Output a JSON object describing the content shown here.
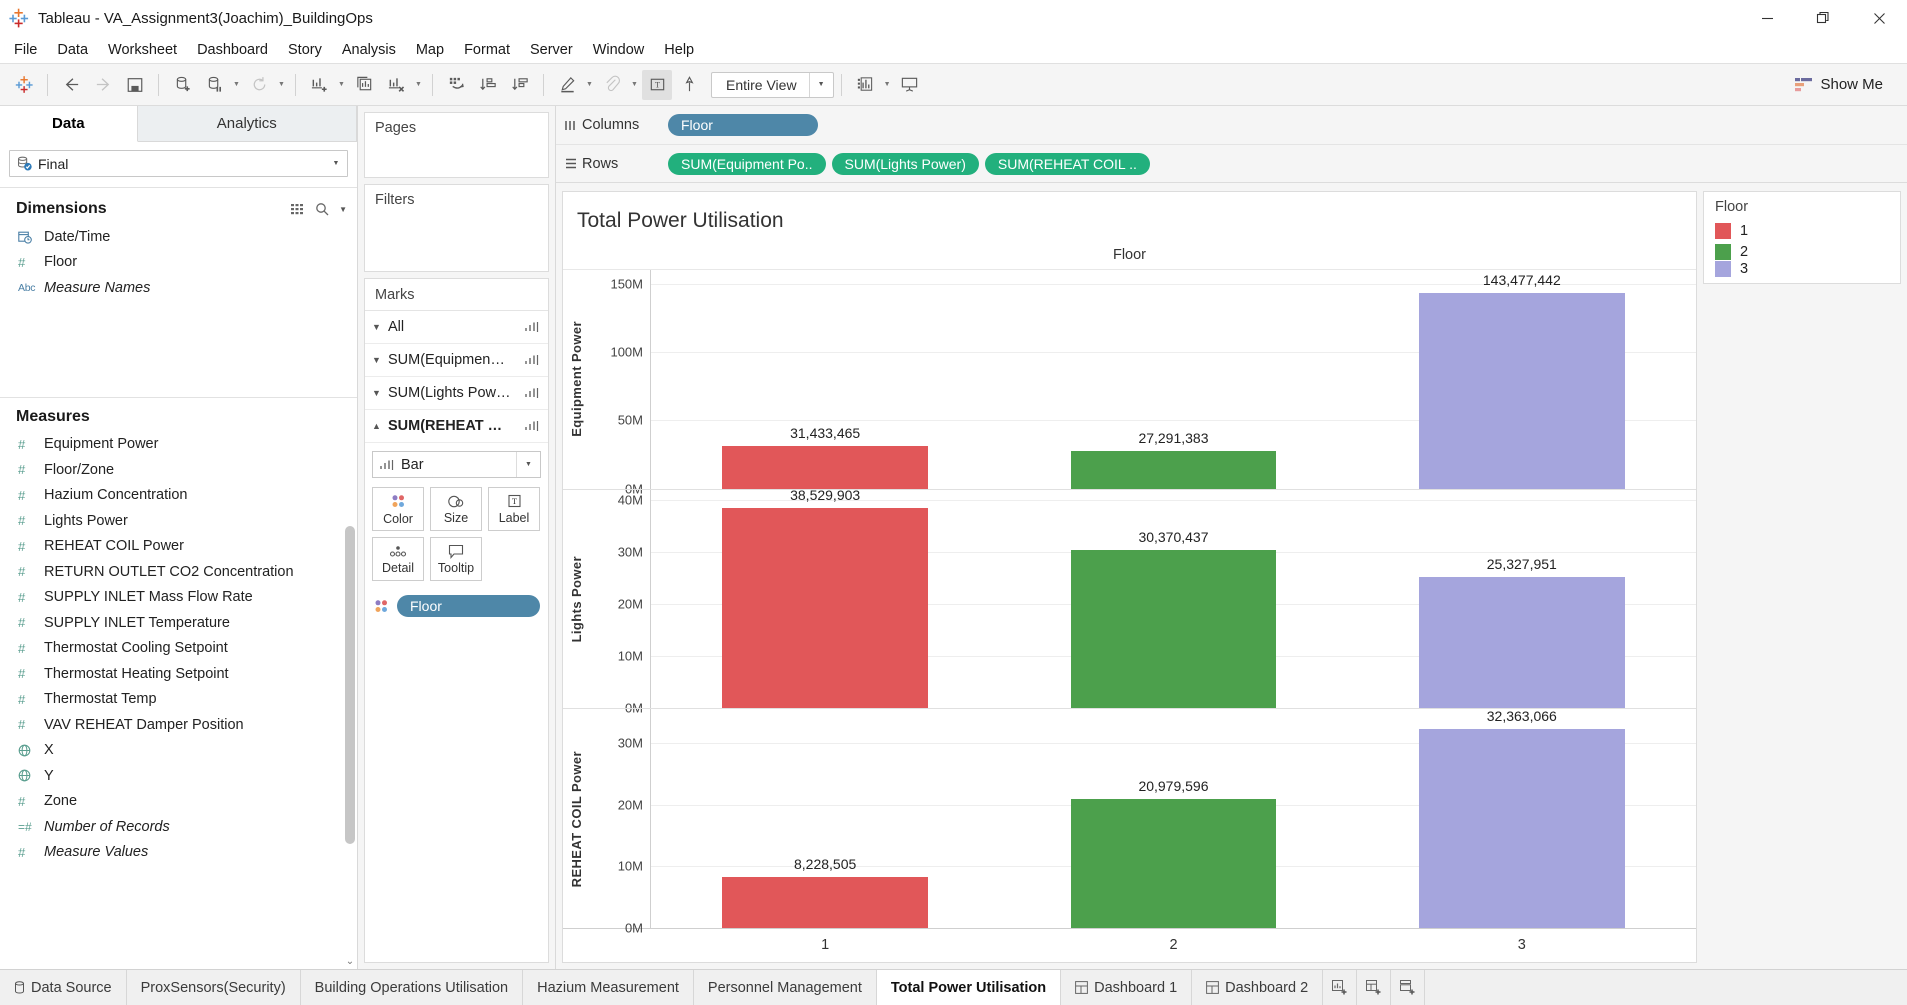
{
  "window": {
    "title": "Tableau - VA_Assignment3(Joachim)_BuildingOps",
    "app_icon": "tableau-logo-icon",
    "minimize": "–",
    "maximize": "❐",
    "close": "✕"
  },
  "menubar": {
    "items": [
      "File",
      "Data",
      "Worksheet",
      "Dashboard",
      "Story",
      "Analysis",
      "Map",
      "Format",
      "Server",
      "Window",
      "Help"
    ]
  },
  "toolbar": {
    "fit_value": "Entire View",
    "show_me_label": "Show Me",
    "icons": [
      "tableau-home-icon",
      "back-arrow-icon",
      "forward-arrow-icon",
      "save-icon",
      "new-data-source-icon",
      "pause-data-updates-icon",
      "refresh-data-source-icon",
      "new-worksheet-icon",
      "duplicate-sheet-icon",
      "clear-sheet-icon",
      "swap-rows-columns-icon",
      "sort-ascending-icon",
      "sort-descending-icon",
      "highlight-icon",
      "group-members-icon",
      "show-mark-labels-icon",
      "fix-axes-icon",
      "presentation-mode-icon",
      "show-me-icon"
    ]
  },
  "data_pane": {
    "tabs": [
      {
        "label": "Data",
        "active": true
      },
      {
        "label": "Analytics",
        "active": false
      }
    ],
    "datasource": {
      "name": "Final",
      "icon": "database-connected-icon"
    },
    "dimensions": {
      "header": "Dimensions",
      "tool_icons": [
        "grid-view-icon",
        "search-icon",
        "chevron-down-icon"
      ],
      "fields": [
        {
          "label": "Date/Time",
          "icon": "calendar-clock-icon",
          "italic": false
        },
        {
          "label": "Floor",
          "icon": "hash-icon",
          "italic": false
        },
        {
          "label": "Measure Names",
          "icon": "abc-icon",
          "italic": true
        }
      ]
    },
    "measures": {
      "header": "Measures",
      "fields": [
        {
          "label": "Equipment Power",
          "icon": "hash-icon",
          "italic": false
        },
        {
          "label": "Floor/Zone",
          "icon": "hash-icon",
          "italic": false
        },
        {
          "label": "Hazium Concentration",
          "icon": "hash-icon",
          "italic": false
        },
        {
          "label": "Lights Power",
          "icon": "hash-icon",
          "italic": false
        },
        {
          "label": "REHEAT COIL Power",
          "icon": "hash-icon",
          "italic": false
        },
        {
          "label": "RETURN OUTLET CO2 Concentration",
          "icon": "hash-icon",
          "italic": false
        },
        {
          "label": "SUPPLY INLET Mass Flow Rate",
          "icon": "hash-icon",
          "italic": false
        },
        {
          "label": "SUPPLY INLET Temperature",
          "icon": "hash-icon",
          "italic": false
        },
        {
          "label": "Thermostat Cooling Setpoint",
          "icon": "hash-icon",
          "italic": false
        },
        {
          "label": "Thermostat Heating Setpoint",
          "icon": "hash-icon",
          "italic": false
        },
        {
          "label": "Thermostat Temp",
          "icon": "hash-icon",
          "italic": false
        },
        {
          "label": "VAV REHEAT Damper Position",
          "icon": "hash-icon",
          "italic": false
        },
        {
          "label": "X",
          "icon": "geo-globe-icon",
          "italic": false
        },
        {
          "label": "Y",
          "icon": "geo-globe-icon",
          "italic": false
        },
        {
          "label": "Zone",
          "icon": "hash-icon",
          "italic": false
        },
        {
          "label": "Number of Records",
          "icon": "calculated-hash-icon",
          "italic": true
        },
        {
          "label": "Measure Values",
          "icon": "hash-icon",
          "italic": true
        }
      ]
    }
  },
  "cards": {
    "pages_header": "Pages",
    "filters_header": "Filters",
    "marks_header": "Marks",
    "mark_rows": [
      {
        "label": "All",
        "expanded": false,
        "active": false
      },
      {
        "label": "SUM(Equipmen…",
        "expanded": false,
        "active": false
      },
      {
        "label": "SUM(Lights Pow…",
        "expanded": false,
        "active": false
      },
      {
        "label": "SUM(REHEAT …",
        "expanded": true,
        "active": true
      }
    ],
    "mark_type": "Bar",
    "buttons": [
      {
        "label": "Color",
        "icon": "color-palette-icon"
      },
      {
        "label": "Size",
        "icon": "size-icon"
      },
      {
        "label": "Label",
        "icon": "label-text-icon"
      },
      {
        "label": "Detail",
        "icon": "detail-dots-icon"
      },
      {
        "label": "Tooltip",
        "icon": "tooltip-bubble-icon"
      }
    ],
    "color_pill": "Floor"
  },
  "shelves": {
    "columns_label": "Columns",
    "columns_icon": "columns-icon",
    "columns_pills": [
      {
        "label": "Floor",
        "color": "blue"
      }
    ],
    "rows_label": "Rows",
    "rows_icon": "rows-icon",
    "rows_pills": [
      {
        "label": "SUM(Equipment Po..",
        "color": "green"
      },
      {
        "label": "SUM(Lights Power)",
        "color": "green"
      },
      {
        "label": "SUM(REHEAT COIL ..",
        "color": "green"
      }
    ]
  },
  "legend": {
    "title": "Floor",
    "entries": [
      {
        "label": "1",
        "color": "#e15759"
      },
      {
        "label": "2",
        "color": "#4ca04c"
      },
      {
        "label": "3",
        "color": "#a5a5dd"
      }
    ]
  },
  "bottom_tabs": {
    "data_source": {
      "label": "Data Source",
      "icon": "data-source-icon"
    },
    "sheets": [
      {
        "label": "ProxSensors(Security)",
        "active": false,
        "icon": null
      },
      {
        "label": "Building Operations Utilisation",
        "active": false,
        "icon": null
      },
      {
        "label": "Hazium Measurement",
        "active": false,
        "icon": null
      },
      {
        "label": "Personnel Management",
        "active": false,
        "icon": null
      },
      {
        "label": "Total Power Utilisation",
        "active": true,
        "icon": null
      },
      {
        "label": "Dashboard 1",
        "active": false,
        "icon": "dashboard-grid-icon"
      },
      {
        "label": "Dashboard 2",
        "active": false,
        "icon": "dashboard-grid-icon"
      }
    ],
    "new_buttons": [
      "new-worksheet-icon",
      "new-dashboard-icon",
      "new-story-icon"
    ]
  },
  "chart_data": {
    "type": "bar",
    "title": "Total Power Utilisation",
    "xlabel": "Floor",
    "categories": [
      "1",
      "2",
      "3"
    ],
    "colors": [
      "#e15759",
      "#4ca04c",
      "#a5a5dd"
    ],
    "panels": [
      {
        "ylabel": "Equipment Power",
        "ylim": [
          0,
          160000000
        ],
        "yticks": [
          0,
          50000000,
          100000000,
          150000000
        ],
        "ytick_labels": [
          "0M",
          "50M",
          "100M",
          "150M"
        ],
        "values": [
          31433465,
          27291383,
          143477442
        ],
        "value_labels": [
          "31,433,465",
          "27,291,383",
          "143,477,442"
        ]
      },
      {
        "ylabel": "Lights Power",
        "ylim": [
          0,
          42000000
        ],
        "yticks": [
          0,
          10000000,
          20000000,
          30000000,
          40000000
        ],
        "ytick_labels": [
          "0M",
          "10M",
          "20M",
          "30M",
          "40M"
        ],
        "values": [
          38529903,
          30370437,
          25327951
        ],
        "value_labels": [
          "38,529,903",
          "30,370,437",
          "25,327,951"
        ]
      },
      {
        "ylabel": "REHEAT COIL Power",
        "ylim": [
          0,
          35500000
        ],
        "yticks": [
          0,
          10000000,
          20000000,
          30000000
        ],
        "ytick_labels": [
          "0M",
          "10M",
          "20M",
          "30M"
        ],
        "values": [
          8228505,
          20979596,
          32363066
        ],
        "value_labels": [
          "8,228,505",
          "20,979,596",
          "32,363,066"
        ]
      }
    ],
    "legend_title": "Floor",
    "legend_position": "right",
    "grid": true
  }
}
